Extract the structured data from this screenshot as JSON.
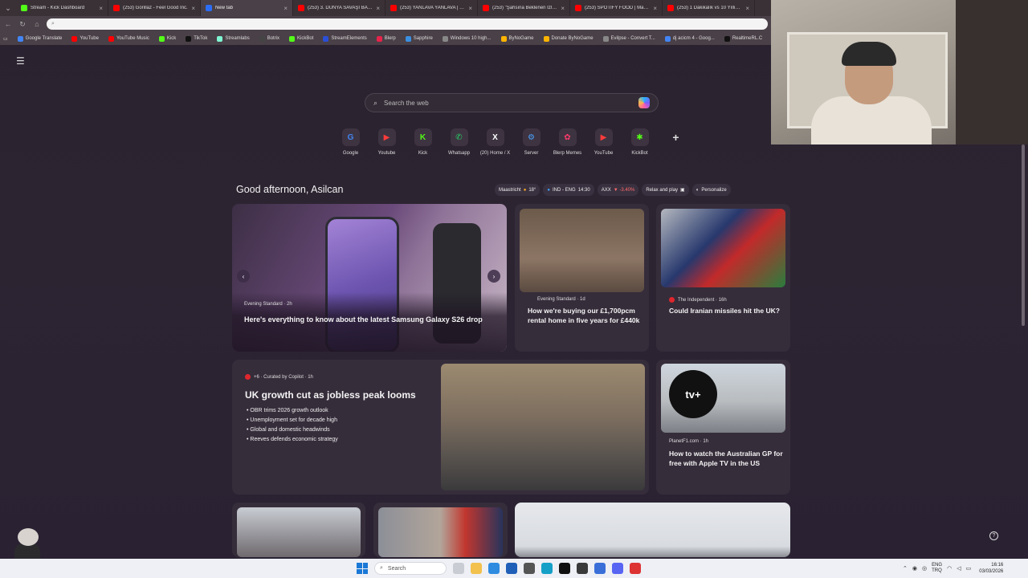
{
  "tabs": [
    {
      "label": "Stream - Kick Dashboard",
      "color": "#53fc18",
      "active": false
    },
    {
      "label": "(253) Gorillaz - Feel Good Inc.",
      "color": "#ff0000",
      "active": false
    },
    {
      "label": "New tab",
      "color": "#2b6ef5",
      "active": true
    },
    {
      "label": "(253) 3. DÜNYA SAVAŞI BAŞLIYOR",
      "color": "#ff0000",
      "active": false
    },
    {
      "label": "(253) YANLAVA YANLAVA | 55mbt",
      "color": "#ff0000",
      "active": false
    },
    {
      "label": "(253) \"Şahsına Beklenen İzlemeli\"",
      "color": "#ff0000",
      "active": false
    },
    {
      "label": "(253) SPOTIFY FOOD | Madara",
      "color": "#ff0000",
      "active": false
    },
    {
      "label": "(253) 1 Dakikalık vs 10 Yıllık ing",
      "color": "#ff0000",
      "active": false
    }
  ],
  "address_bar": {
    "placeholder": "",
    "value": ""
  },
  "bookmarks": [
    {
      "label": "Google Translate",
      "color": "#4285f4"
    },
    {
      "label": "YouTube",
      "color": "#ff0000"
    },
    {
      "label": "YouTube Music",
      "color": "#ff0000"
    },
    {
      "label": "Kick",
      "color": "#53fc18"
    },
    {
      "label": "TikTok",
      "color": "#111111"
    },
    {
      "label": "Streamlabs",
      "color": "#80f5d2"
    },
    {
      "label": "Botrix",
      "color": "#444444"
    },
    {
      "label": "KickBot",
      "color": "#53fc18"
    },
    {
      "label": "StreamElements",
      "color": "#2b4fd6"
    },
    {
      "label": "Blerp",
      "color": "#e7234b"
    },
    {
      "label": "Sapphire",
      "color": "#3a8fe0"
    },
    {
      "label": "Windows 10 high...",
      "color": "#888888"
    },
    {
      "label": "ByNoGame",
      "color": "#ffb400"
    },
    {
      "label": "Donate ByNoGame",
      "color": "#ffb400"
    },
    {
      "label": "Evilpse - Convert T...",
      "color": "#888888"
    },
    {
      "label": "dj acicm 4 - Goog...",
      "color": "#4285f4"
    },
    {
      "label": "RealtimeRL.C",
      "color": "#111111"
    }
  ],
  "search": {
    "placeholder": "Search the web"
  },
  "quick_links": [
    {
      "label": "Google",
      "glyph": "G",
      "color": "#4285f4"
    },
    {
      "label": "Youtube",
      "glyph": "▶",
      "color": "#ff3b3b"
    },
    {
      "label": "Kick",
      "glyph": "K",
      "color": "#53fc18"
    },
    {
      "label": "Whatsapp",
      "glyph": "✆",
      "color": "#25d366"
    },
    {
      "label": "(20) Home / X",
      "glyph": "X",
      "color": "#ffffff"
    },
    {
      "label": "Server",
      "glyph": "⚙",
      "color": "#4aa3ff"
    },
    {
      "label": "Blerp Memes",
      "glyph": "✿",
      "color": "#ff3b6b"
    },
    {
      "label": "YouTube",
      "glyph": "▶",
      "color": "#ff3b3b"
    },
    {
      "label": "KickBot",
      "glyph": "✱",
      "color": "#53fc18"
    }
  ],
  "add_shortcut": "+",
  "greeting": "Good afternoon, Asilcan",
  "chips": {
    "weather": "Maastricht",
    "weather_temp": "18°",
    "cricket": "IND - ENG",
    "cricket_time": "14:30",
    "stock": "AXX",
    "stock_change": "▼ -3.40%",
    "relax": "Relax and play",
    "personalize": "Personalize"
  },
  "cards": {
    "hero": {
      "source": "Evening Standard · 2h",
      "headline": "Here's everything to know about the latest Samsung Galaxy S26 drop"
    },
    "rental": {
      "source": "Evening Standard · 1d",
      "headline": "How we're buying our £1,700pcm rental home in five years for £440k"
    },
    "iran": {
      "source": "The Independent · 16h",
      "headline": "Could Iranian missiles hit the UK?"
    },
    "uk_growth": {
      "source": "+6 · Curated by Copilot · 1h",
      "headline": "UK growth cut as jobless peak looms",
      "bullets": [
        "OBR trims 2026 growth outlook",
        "Unemployment set for decade high",
        "Global and domestic headwinds",
        "Reeves defends economic strategy"
      ]
    },
    "f1": {
      "source": "PlanetF1.com · 1h",
      "headline": "How to watch the Australian GP for free with Apple TV in the US",
      "logo": "tv+"
    }
  },
  "taskbar": {
    "search_label": "Search",
    "lang": "ENG",
    "lang2": "TRQ",
    "time": "16:16",
    "date": "03/03/2026"
  }
}
